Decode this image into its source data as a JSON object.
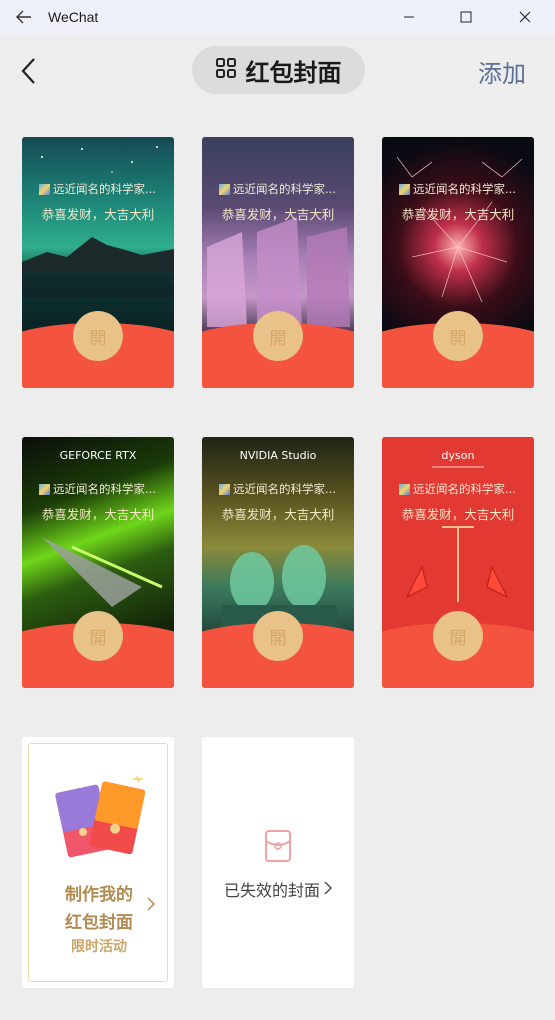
{
  "window": {
    "title": "WeChat",
    "icons": {
      "back": "arrow-left-icon",
      "minimize": "minimize-icon",
      "maximize": "maximize-icon",
      "close": "close-icon"
    }
  },
  "header": {
    "title": "红包封面",
    "add_label": "添加",
    "icons": {
      "back": "chevron-left-icon",
      "title": "grid-icon"
    }
  },
  "colors": {
    "red": "#f3533f",
    "seal": "#e9c28a",
    "gold_text": "#b28b52",
    "add_link": "#5c6f96"
  },
  "covers": [
    {
      "sender": "远近闻名的科学家...",
      "wish": "恭喜发财，大吉大利",
      "seal": "開",
      "brand": ""
    },
    {
      "sender": "远近闻名的科学家...",
      "wish": "恭喜发财，大吉大利",
      "seal": "開",
      "brand": ""
    },
    {
      "sender": "远近闻名的科学家...",
      "wish": "恭喜发财，大吉大利",
      "seal": "開",
      "brand": ""
    },
    {
      "sender": "远近闻名的科学家...",
      "wish": "恭喜发财，大吉大利",
      "seal": "開",
      "brand": "GEFORCE RTX"
    },
    {
      "sender": "远近闻名的科学家...",
      "wish": "恭喜发财，大吉大利",
      "seal": "開",
      "brand": "NVIDIA Studio"
    },
    {
      "sender": "远近闻名的科学家...",
      "wish": "恭喜发财，大吉大利",
      "seal": "開",
      "brand": "dyson"
    }
  ],
  "make_card": {
    "line1": "制作我的",
    "line2": "红包封面",
    "line3": "限时活动",
    "icon": "red-envelopes-icon"
  },
  "expired_card": {
    "label": "已失效的封面",
    "icon": "envelope-outline-icon"
  }
}
